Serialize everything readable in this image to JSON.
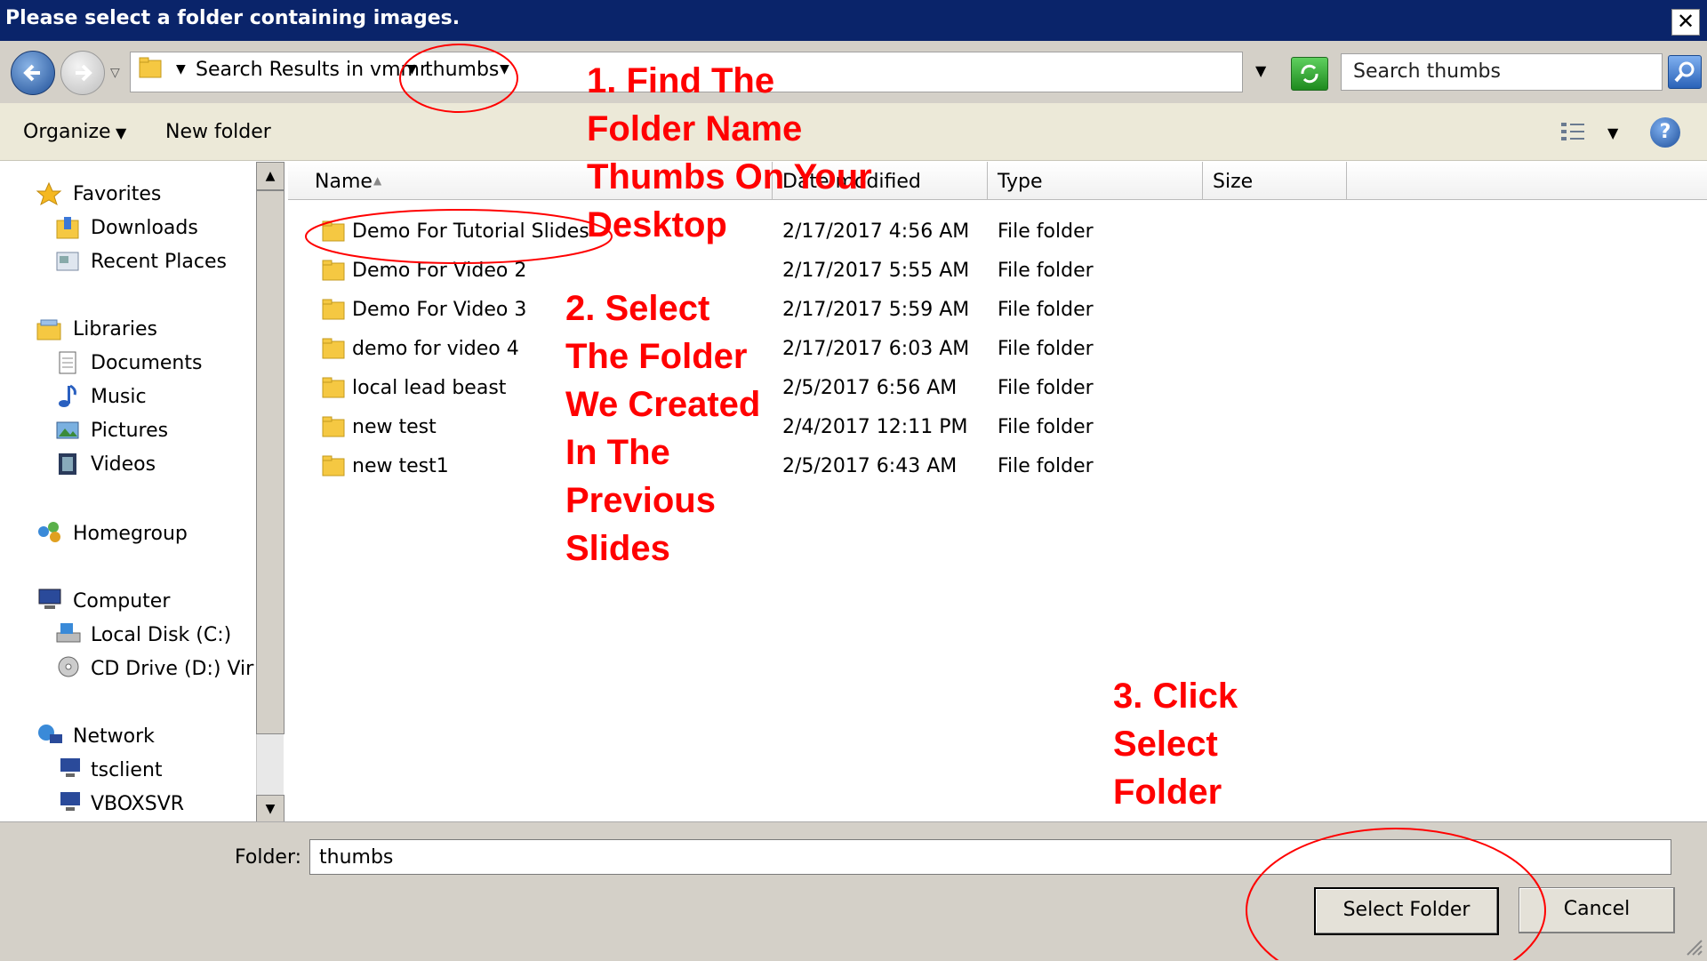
{
  "window": {
    "title": "Please select a folder containing images.",
    "close_glyph": "✕"
  },
  "address": {
    "crumbs": [
      "Search Results in vmmr",
      "thumbs"
    ],
    "search_placeholder": "Search thumbs"
  },
  "toolbar": {
    "organize_label": "Organize",
    "new_folder_label": "New folder",
    "help_glyph": "?"
  },
  "nav": {
    "favorites": {
      "label": "Favorites",
      "items": [
        "Downloads",
        "Recent Places"
      ]
    },
    "libraries": {
      "label": "Libraries",
      "items": [
        "Documents",
        "Music",
        "Pictures",
        "Videos"
      ]
    },
    "homegroup": {
      "label": "Homegroup"
    },
    "computer": {
      "label": "Computer",
      "items": [
        "Local Disk (C:)",
        "CD Drive (D:) Virtu"
      ]
    },
    "network": {
      "label": "Network",
      "items": [
        "tsclient",
        "VBOXSVR"
      ]
    }
  },
  "columns": {
    "name": "Name",
    "date": "Date modified",
    "type": "Type",
    "size": "Size"
  },
  "files": [
    {
      "name": "Demo For Tutorial Slides",
      "date": "2/17/2017 4:56 AM",
      "type": "File folder"
    },
    {
      "name": "Demo For Video 2",
      "date": "2/17/2017 5:55 AM",
      "type": "File folder"
    },
    {
      "name": "Demo For Video 3",
      "date": "2/17/2017 5:59 AM",
      "type": "File folder"
    },
    {
      "name": "demo for video 4",
      "date": "2/17/2017 6:03 AM",
      "type": "File folder"
    },
    {
      "name": "local lead beast",
      "date": "2/5/2017 6:56 AM",
      "type": "File folder"
    },
    {
      "name": "new test",
      "date": "2/4/2017 12:11 PM",
      "type": "File folder"
    },
    {
      "name": "new test1",
      "date": "2/5/2017 6:43 AM",
      "type": "File folder"
    }
  ],
  "bottom": {
    "folder_label": "Folder:",
    "folder_value": "thumbs",
    "select_label": "Select Folder",
    "cancel_label": "Cancel"
  },
  "annotations": {
    "step1": [
      "1. Find The",
      "Folder Name",
      "Thumbs On Your",
      "Desktop"
    ],
    "step2": [
      "2. Select",
      "The Folder",
      "We Created",
      "In The",
      "Previous",
      "Slides"
    ],
    "step3": [
      "3. Click",
      "Select",
      "Folder"
    ],
    "color": "#ff0000"
  },
  "colors": {
    "titlebar": "#0a246a",
    "chrome": "#d4d0c8"
  }
}
